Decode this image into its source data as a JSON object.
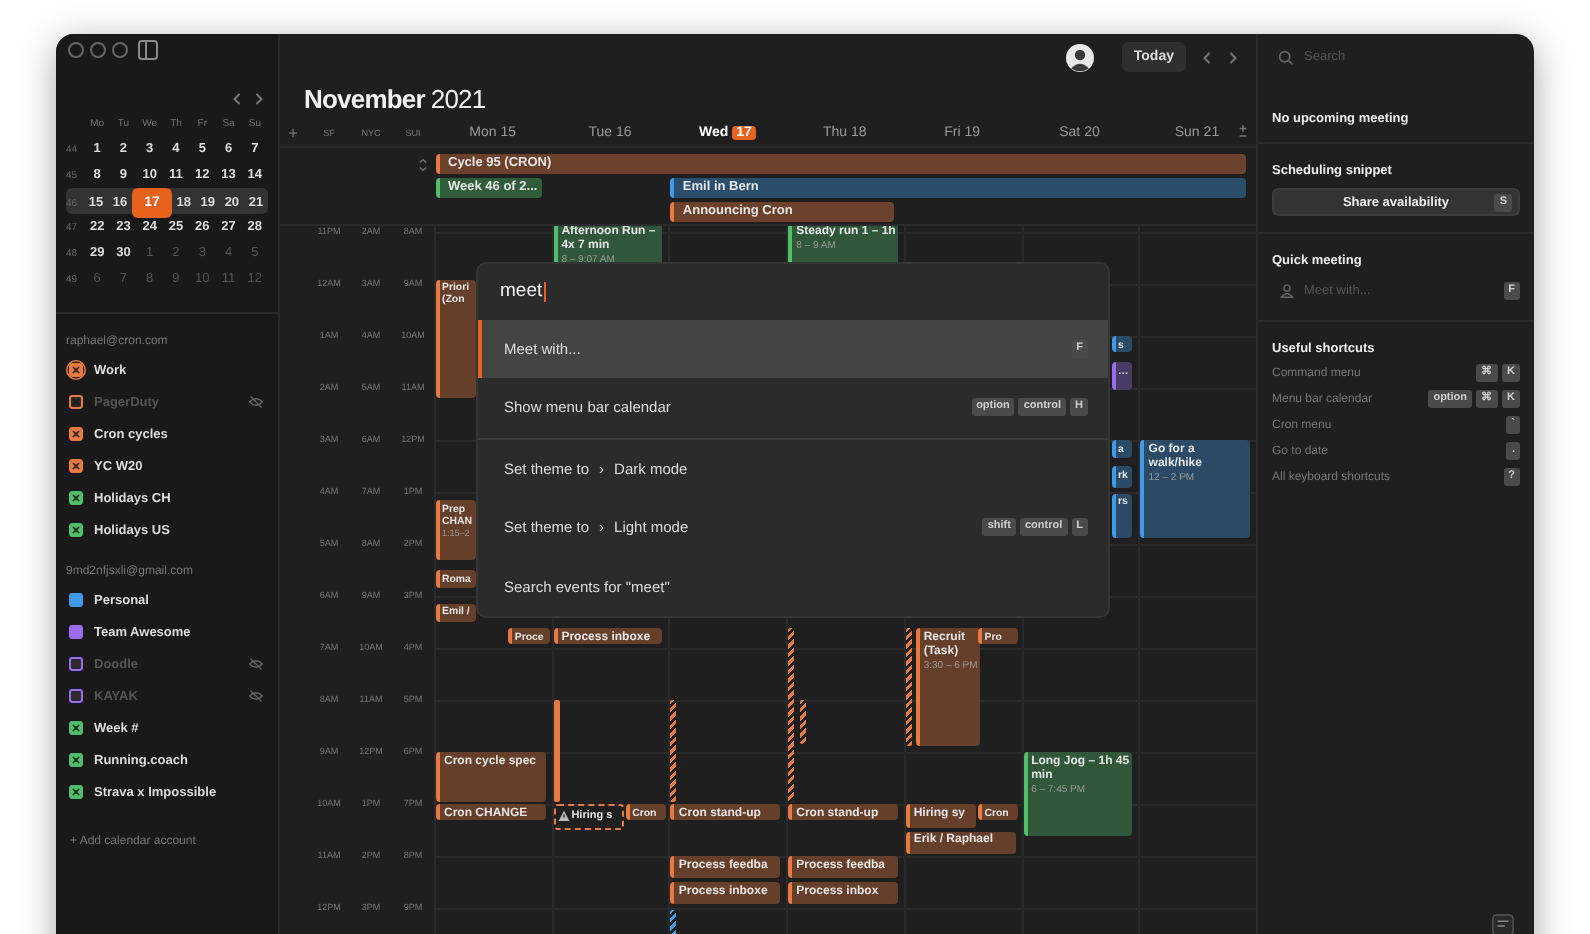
{
  "mini_calendar": {
    "weekdays": [
      "Mo",
      "Tu",
      "We",
      "Th",
      "Fr",
      "Sa",
      "Su"
    ],
    "weeks": [
      {
        "number": "44",
        "selected": false,
        "days": [
          {
            "label": "1",
            "in_month": true,
            "today": false
          },
          {
            "label": "2",
            "in_month": true,
            "today": false
          },
          {
            "label": "3",
            "in_month": true,
            "today": false
          },
          {
            "label": "4",
            "in_month": true,
            "today": false
          },
          {
            "label": "5",
            "in_month": true,
            "today": false
          },
          {
            "label": "6",
            "in_month": true,
            "today": false
          },
          {
            "label": "7",
            "in_month": true,
            "today": false
          }
        ]
      },
      {
        "number": "45",
        "selected": false,
        "days": [
          {
            "label": "8",
            "in_month": true,
            "today": false
          },
          {
            "label": "9",
            "in_month": true,
            "today": false
          },
          {
            "label": "10",
            "in_month": true,
            "today": false
          },
          {
            "label": "11",
            "in_month": true,
            "today": false
          },
          {
            "label": "12",
            "in_month": true,
            "today": false
          },
          {
            "label": "13",
            "in_month": true,
            "today": false
          },
          {
            "label": "14",
            "in_month": true,
            "today": false
          }
        ]
      },
      {
        "number": "46",
        "selected": true,
        "days": [
          {
            "label": "15",
            "in_month": true,
            "today": false
          },
          {
            "label": "16",
            "in_month": true,
            "today": false
          },
          {
            "label": "17",
            "in_month": true,
            "today": true
          },
          {
            "label": "18",
            "in_month": true,
            "today": false
          },
          {
            "label": "19",
            "in_month": true,
            "today": false
          },
          {
            "label": "20",
            "in_month": true,
            "today": false
          },
          {
            "label": "21",
            "in_month": true,
            "today": false
          }
        ]
      },
      {
        "number": "47",
        "selected": false,
        "days": [
          {
            "label": "22",
            "in_month": true,
            "today": false
          },
          {
            "label": "23",
            "in_month": true,
            "today": false
          },
          {
            "label": "24",
            "in_month": true,
            "today": false
          },
          {
            "label": "25",
            "in_month": true,
            "today": false
          },
          {
            "label": "26",
            "in_month": true,
            "today": false
          },
          {
            "label": "27",
            "in_month": true,
            "today": false
          },
          {
            "label": "28",
            "in_month": true,
            "today": false
          }
        ]
      },
      {
        "number": "48",
        "selected": false,
        "days": [
          {
            "label": "29",
            "in_month": true,
            "today": false
          },
          {
            "label": "30",
            "in_month": true,
            "today": false
          },
          {
            "label": "1",
            "in_month": false,
            "today": false
          },
          {
            "label": "2",
            "in_month": false,
            "today": false
          },
          {
            "label": "3",
            "in_month": false,
            "today": false
          },
          {
            "label": "4",
            "in_month": false,
            "today": false
          },
          {
            "label": "5",
            "in_month": false,
            "today": false
          }
        ]
      },
      {
        "number": "49",
        "selected": false,
        "days": [
          {
            "label": "6",
            "in_month": false,
            "today": false
          },
          {
            "label": "7",
            "in_month": false,
            "today": false
          },
          {
            "label": "8",
            "in_month": false,
            "today": false
          },
          {
            "label": "9",
            "in_month": false,
            "today": false
          },
          {
            "label": "10",
            "in_month": false,
            "today": false
          },
          {
            "label": "11",
            "in_month": false,
            "today": false
          },
          {
            "label": "12",
            "in_month": false,
            "today": false
          }
        ]
      }
    ]
  },
  "accounts": [
    {
      "email": "raphael@cron.com",
      "calendars": [
        {
          "name": "Work",
          "color": "#e8793f",
          "checked": true,
          "visible": true,
          "selected": true
        },
        {
          "name": "PagerDuty",
          "color": "#e8793f",
          "checked": true,
          "visible": false,
          "selected": false
        },
        {
          "name": "Cron cycles",
          "color": "#e8793f",
          "checked": true,
          "visible": true,
          "selected": false
        },
        {
          "name": "YC W20",
          "color": "#e8793f",
          "checked": true,
          "visible": true,
          "selected": false
        },
        {
          "name": "Holidays CH",
          "color": "#4fbf6a",
          "checked": true,
          "visible": true,
          "selected": false
        },
        {
          "name": "Holidays US",
          "color": "#4fbf6a",
          "checked": true,
          "visible": true,
          "selected": false
        }
      ]
    },
    {
      "email": "9md2nfjsxli@gmail.com",
      "calendars": [
        {
          "name": "Personal",
          "color": "#3d9be9",
          "checked": false,
          "visible": true,
          "selected": false
        },
        {
          "name": "Team Awesome",
          "color": "#9b6cf0",
          "checked": false,
          "visible": true,
          "selected": false
        },
        {
          "name": "Doodle",
          "color": "#9b6cf0",
          "checked": false,
          "visible": false,
          "selected": false
        },
        {
          "name": "KAYAK",
          "color": "#9b6cf0",
          "checked": false,
          "visible": false,
          "selected": false
        },
        {
          "name": "Week #",
          "color": "#4fbf6a",
          "checked": true,
          "visible": true,
          "selected": false
        },
        {
          "name": "Running.coach",
          "color": "#4fbf6a",
          "checked": true,
          "visible": true,
          "selected": false
        },
        {
          "name": "Strava x Impossible",
          "color": "#4fbf6a",
          "checked": true,
          "visible": true,
          "selected": false
        }
      ]
    }
  ],
  "add_account": "+ Add calendar account",
  "toolbar": {
    "today_button": "Today"
  },
  "title": {
    "month": "November",
    "year": "2021"
  },
  "timezones": [
    "SF",
    "NYC",
    "SUI"
  ],
  "days": [
    {
      "name": "Mon",
      "date": "15",
      "today": false
    },
    {
      "name": "Tue",
      "date": "16",
      "today": false
    },
    {
      "name": "Wed",
      "date": "17",
      "today": true
    },
    {
      "name": "Thu",
      "date": "18",
      "today": false
    },
    {
      "name": "Fri",
      "date": "19",
      "today": false
    },
    {
      "name": "Sat",
      "date": "20",
      "today": false
    },
    {
      "name": "Sun",
      "date": "21",
      "today": false
    }
  ],
  "all_day_events": [
    {
      "title": "Cycle 95 (CRON)",
      "color": "#e8793f"
    },
    {
      "title": "Week 46 of 2...",
      "color": "#4fbf6a"
    },
    {
      "title": "Emil in Bern",
      "color": "#3d9be9"
    },
    {
      "title": "Announcing Cron",
      "color": "#e8793f"
    }
  ],
  "hours": [
    {
      "sf": "11PM",
      "nyc": "2AM",
      "sui": "8AM"
    },
    {
      "sf": "12AM",
      "nyc": "3AM",
      "sui": "9AM"
    },
    {
      "sf": "1AM",
      "nyc": "4AM",
      "sui": "10AM"
    },
    {
      "sf": "2AM",
      "nyc": "5AM",
      "sui": "11AM"
    },
    {
      "sf": "3AM",
      "nyc": "6AM",
      "sui": "12PM"
    },
    {
      "sf": "4AM",
      "nyc": "7AM",
      "sui": "1PM"
    },
    {
      "sf": "5AM",
      "nyc": "8AM",
      "sui": "2PM"
    },
    {
      "sf": "6AM",
      "nyc": "9AM",
      "sui": "3PM"
    },
    {
      "sf": "7AM",
      "nyc": "10AM",
      "sui": "4PM"
    },
    {
      "sf": "8AM",
      "nyc": "11AM",
      "sui": "5PM"
    },
    {
      "sf": "9AM",
      "nyc": "12PM",
      "sui": "6PM"
    },
    {
      "sf": "10AM",
      "nyc": "1PM",
      "sui": "7PM"
    },
    {
      "sf": "11AM",
      "nyc": "2PM",
      "sui": "8PM"
    },
    {
      "sf": "12PM",
      "nyc": "3PM",
      "sui": "9PM"
    }
  ],
  "events": [
    {
      "kind": "event",
      "title": "Afternoon Run – 4x 7 min",
      "time": "8 – 9:07 AM",
      "color": "#4fbf6a"
    },
    {
      "kind": "event",
      "title": "Steady run 1 – 1h",
      "time": "8 – 9 AM",
      "color": "#4fbf6a"
    },
    {
      "kind": "event",
      "title": "Priori (Zon",
      "color": "#e8793f"
    },
    {
      "kind": "event",
      "title": "s",
      "color": "#3d9be9"
    },
    {
      "kind": "event",
      "title": "…",
      "color": "#9b6cf0"
    },
    {
      "kind": "event",
      "title": "a",
      "color": "#3d9be9"
    },
    {
      "kind": "event",
      "title": "rk",
      "color": "#3d9be9"
    },
    {
      "kind": "event",
      "title": "rs",
      "color": "#3d9be9"
    },
    {
      "kind": "event",
      "title": "Go for a walk/hike",
      "time": "12 – 2 PM",
      "color": "#3d9be9"
    },
    {
      "kind": "event",
      "title": "Prep CHAN",
      "time": "1:15–2",
      "color": "#e8793f"
    },
    {
      "kind": "event",
      "title": "Roma",
      "color": "#e8793f"
    },
    {
      "kind": "event",
      "title": "Emil /",
      "color": "#e8793f"
    },
    {
      "kind": "event",
      "title": "Proce",
      "color": "#e8793f"
    },
    {
      "kind": "event",
      "title": "Process inboxe",
      "color": "#e8793f"
    },
    {
      "kind": "bar",
      "color": "#e8793f",
      "hatched": true
    },
    {
      "kind": "bar",
      "color": "#e8793f",
      "hatched": true
    },
    {
      "kind": "event",
      "title": "Recruit (Task)",
      "time": "3:30 – 6 PM",
      "color": "#e8793f"
    },
    {
      "kind": "event",
      "title": "Pro",
      "color": "#e8793f"
    },
    {
      "kind": "bar",
      "color": "#e8793f",
      "hatched": false
    },
    {
      "kind": "bar",
      "color": "#e8793f",
      "hatched": true
    },
    {
      "kind": "bar",
      "color": "#e8793f",
      "hatched": true
    },
    {
      "kind": "event",
      "title": "Cron cycle spec",
      "color": "#e8793f"
    },
    {
      "kind": "event",
      "title": "Cron CHANGE",
      "color": "#e8793f"
    },
    {
      "kind": "tentative",
      "title": "Hiring s",
      "color": "#e8793f"
    },
    {
      "kind": "event",
      "title": "Cron",
      "color": "#e8793f"
    },
    {
      "kind": "event",
      "title": "Cron stand-up",
      "color": "#e8793f"
    },
    {
      "kind": "event",
      "title": "Cron stand-up",
      "color": "#e8793f"
    },
    {
      "kind": "event",
      "title": "Hiring sy",
      "color": "#e8793f"
    },
    {
      "kind": "event",
      "title": "Cron",
      "color": "#e8793f"
    },
    {
      "kind": "event",
      "title": "Erik / Raphael",
      "color": "#e8793f"
    },
    {
      "kind": "event",
      "title": "Long Jog – 1h 45 min",
      "time": "6 – 7:45 PM",
      "color": "#4fbf6a"
    },
    {
      "kind": "event",
      "title": "Process feedba",
      "color": "#e8793f"
    },
    {
      "kind": "event",
      "title": "Process feedba",
      "color": "#e8793f"
    },
    {
      "kind": "event",
      "title": "Process inboxe",
      "color": "#e8793f"
    },
    {
      "kind": "event",
      "title": "Process inbox",
      "color": "#e8793f"
    },
    {
      "kind": "bar",
      "color": "#3d9be9",
      "hatched": true
    }
  ],
  "command_palette": {
    "value": "meet",
    "groups": [
      [
        {
          "parts": [
            "Meet with..."
          ],
          "keys": [
            "F"
          ],
          "selected": true
        },
        {
          "parts": [
            "Show menu bar calendar"
          ],
          "keys": [
            "option",
            "control",
            "H"
          ],
          "selected": false
        }
      ],
      [
        {
          "parts": [
            "Set theme to",
            "›",
            "Dark mode"
          ],
          "selected": false
        },
        {
          "parts": [
            "Set theme to",
            "›",
            "Light mode"
          ],
          "keys": [
            "shift",
            "control",
            "L"
          ],
          "selected": false
        },
        {
          "parts": [
            "Search events for \"meet\""
          ],
          "selected": false
        }
      ]
    ]
  },
  "right_panel": {
    "search": {
      "placeholder": "Search"
    },
    "upcoming": "No upcoming meeting",
    "scheduling": {
      "heading": "Scheduling snippet",
      "button": "Share availability",
      "key": "S"
    },
    "quick_meeting": {
      "heading": "Quick meeting",
      "placeholder": "Meet with...",
      "key": "F"
    },
    "shortcuts": {
      "heading": "Useful shortcuts",
      "items": [
        {
          "label": "Command menu",
          "keys": [
            "⌘",
            "K"
          ]
        },
        {
          "label": "Menu bar calendar",
          "keys": [
            "option",
            "⌘",
            "K"
          ]
        },
        {
          "label": "Cron menu",
          "keys": [
            "`"
          ]
        },
        {
          "label": "Go to date",
          "keys": [
            "."
          ]
        },
        {
          "label": "All keyboard shortcuts",
          "keys": [
            "?"
          ]
        }
      ]
    }
  }
}
